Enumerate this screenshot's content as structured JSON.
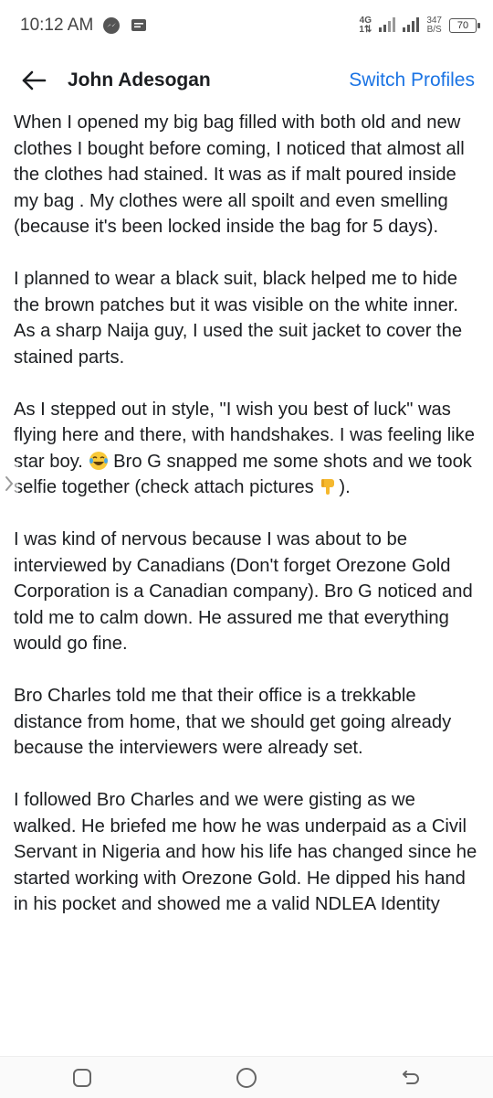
{
  "status_bar": {
    "time": "10:12 AM",
    "network_type": "4G",
    "network_sub": "1⇅",
    "speed_value": "347",
    "speed_unit": "B/S",
    "battery": "70"
  },
  "header": {
    "title": "John Adesogan",
    "action_label": "Switch Profiles",
    "accent_color": "#1b74e4"
  },
  "post": {
    "paragraphs": [
      "When I opened my big bag filled with both old and new clothes I bought before coming, I noticed that almost all the clothes had stained. It was as if malt poured inside my bag . My clothes were all spoilt and even smelling (because it's been locked inside the bag for 5 days).",
      "I planned to wear a black suit, black helped me to hide the brown patches but it was visible on the white inner. As a sharp Naija guy, I used the suit jacket to cover the stained parts.",
      "I was kind of nervous because I was about to be interviewed by Canadians (Don't forget Orezone Gold Corporation is a Canadian company). Bro G noticed and told me to calm down. He assured me that everything would go fine.",
      "Bro Charles told me that their office is a trekkable distance from home, that we should get going already because the interviewers were already set.",
      "I followed Bro Charles and we were gisting as we walked. He briefed me how he was underpaid as a Civil Servant in Nigeria and how his life has changed since he started working with Orezone Gold. He dipped his hand in his pocket and showed me a valid NDLEA Identity"
    ],
    "emoji_paragraph": {
      "part1": "As I stepped out in style, \"I wish you best of luck\" was flying here and there, with handshakes. I was feeling like star boy. ",
      "part2": " Bro G snapped me some shots and we took selfie together (check attach pictures ",
      "part3": ")."
    },
    "emoji_icons": [
      "laughing-tears-emoji",
      "pointing-down-emoji"
    ]
  },
  "nav_icons": [
    "recents-icon",
    "home-icon",
    "back-icon"
  ]
}
